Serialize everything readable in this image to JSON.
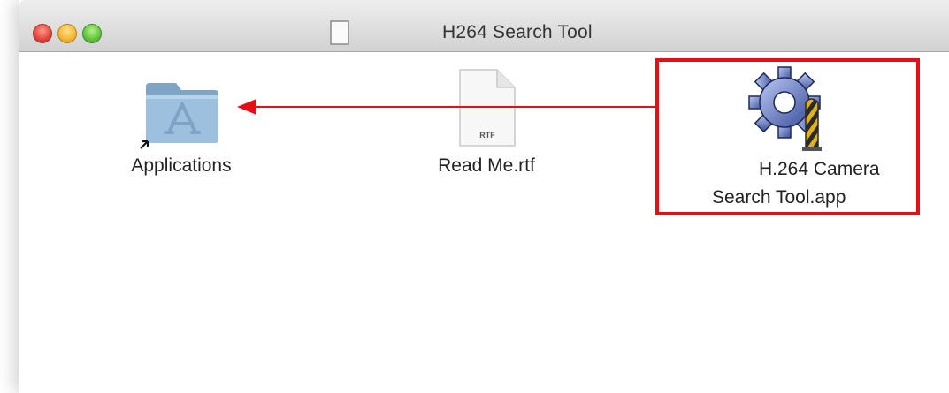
{
  "window": {
    "title": "H264 Search Tool"
  },
  "items": {
    "applications": {
      "label": "Applications"
    },
    "readme": {
      "label": "Read Me.rtf",
      "file_badge": "RTF"
    },
    "app": {
      "label_line1": "H.264 Camera",
      "label_line2": "Search Tool.app"
    }
  },
  "annotation": {
    "highlight_color": "#e3101a",
    "arrow_color": "#e3101a",
    "meaning": "drag app to Applications"
  }
}
